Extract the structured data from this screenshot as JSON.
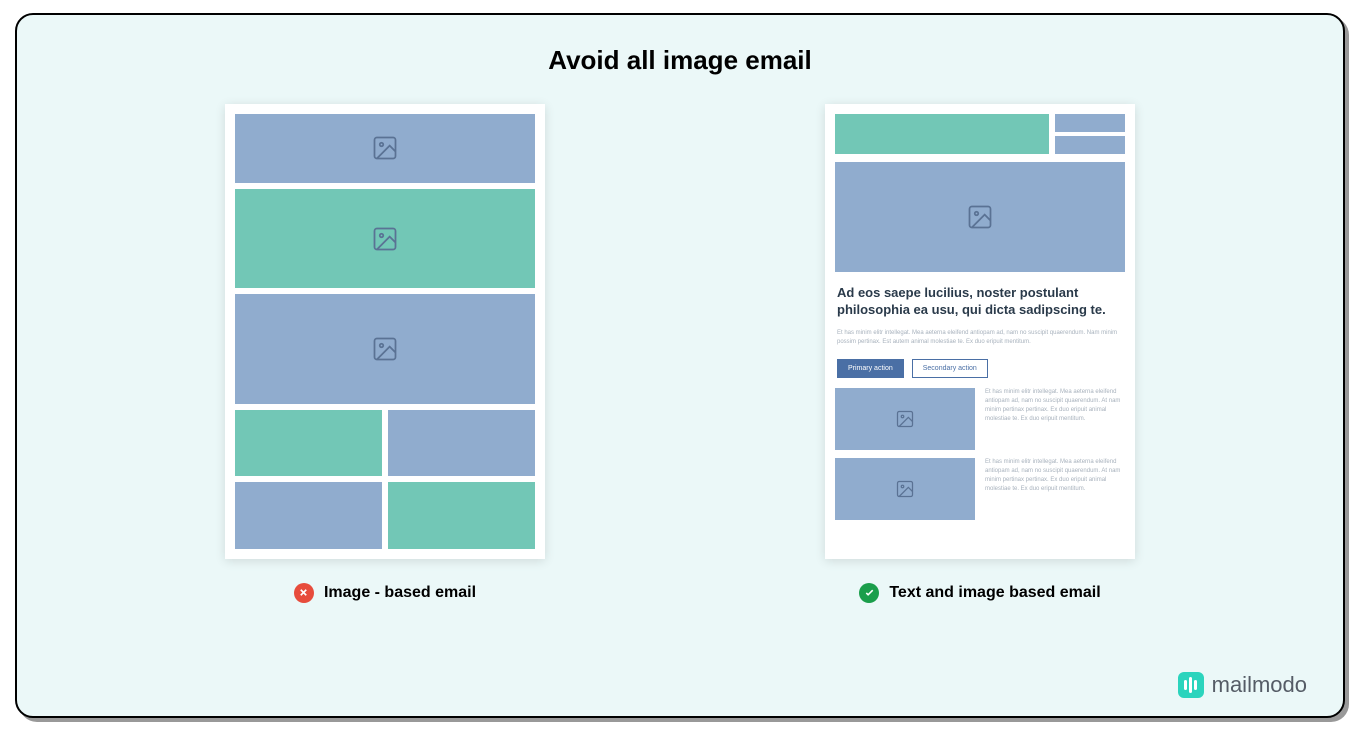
{
  "title": "Avoid all image email",
  "left": {
    "caption": "Image - based email"
  },
  "right": {
    "caption": "Text  and image based email",
    "heading": "Ad eos saepe lucilius, noster postulant philosophia ea usu, qui dicta sadipscing te.",
    "paragraph": "Et has minim elitr intellegat. Mea aeterna eleifend antiopam ad, nam no suscipit quaerendum. Nam minim possim pertinax. Est autem animal molestiae te. Ex duo eripuit mentitum.",
    "btn_primary": "Primary action",
    "btn_secondary": "Secondary action",
    "media_text": "Et has minim elitr intellegat. Mea aeterna eleifend antiopam ad, nam no suscipit quaerendum. At nam minim pertinax pertinax. Ex duo eripuit animal molestiae te. Ex duo eripuit mentitum."
  },
  "brand": "mailmodo"
}
